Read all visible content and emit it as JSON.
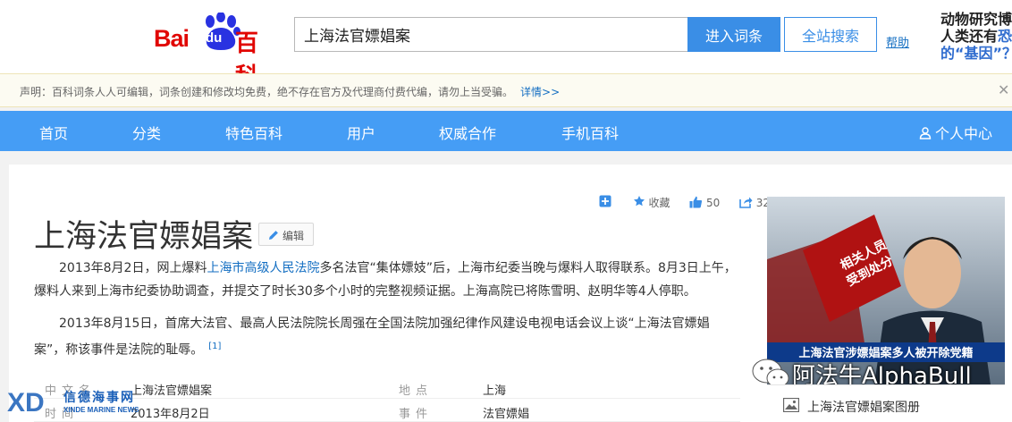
{
  "header": {
    "logo_bai": "Bai",
    "logo_du": "du",
    "logo_ke": "百科",
    "search_value": "上海法官嫖娼案",
    "enter_label": "进入词条",
    "site_search_label": "全站搜索",
    "help": "帮助",
    "promo_line1": "动物研究博",
    "promo_line2": "人类还有",
    "promo_line2_b": "恐",
    "promo_line3": "的“基因”？"
  },
  "notice": {
    "text": "声明：百科词条人人可编辑，词条创建和修改均免费，绝不存在官方及代理商付费代编，请勿上当受骗。",
    "more": "详情>>",
    "close": "✕"
  },
  "nav": {
    "items": [
      "首页",
      "分类",
      "特色百科",
      "用户",
      "权威合作",
      "手机百科"
    ],
    "user": "个人中心"
  },
  "article": {
    "tools": {
      "collect": "收藏",
      "likes": "50",
      "shares": "32"
    },
    "title": "上海法官嫖娼案",
    "edit": "编辑",
    "p1_a": "2013年8月2日，网上爆料",
    "p1_link": "上海市高级人民法院",
    "p1_b": "多名法官“集体嫖妓”后，上海市纪委当晚与爆料人取得联系。8月3日上午，爆料人来到上海市纪委协助调查，并提交了时长30多个小时的完整视频证据。上海高院已将陈雪明、赵明华等4人停职。",
    "p2": "2013年8月15日，首席大法官、最高人民法院院长周强在全国法院加强纪律作风建设电视电话会议上谈“上海法官嫖娼案”，称该事件是法院的耻辱。",
    "p2_ref": "[1]",
    "info": [
      {
        "k1": "中文名",
        "v1": "上海法官嫖娼案",
        "k2": "地点",
        "v2": "上海"
      },
      {
        "k1": "时间",
        "v1": "2013年8月2日",
        "k2": "事件",
        "v2": "法官嫖娼"
      }
    ]
  },
  "image": {
    "badge_line1": "相关人员",
    "badge_line2": "受到处分",
    "banner": "上海法官涉嫖娼案多人被开除党籍",
    "caption": "上海法官嫖娼案图册"
  },
  "watermark": {
    "wechat": "阿法牛AlphaBull",
    "xd_main": "XD",
    "xd_cn": "信德海事网",
    "xd_en": "XINDE MARINE NEWS"
  }
}
